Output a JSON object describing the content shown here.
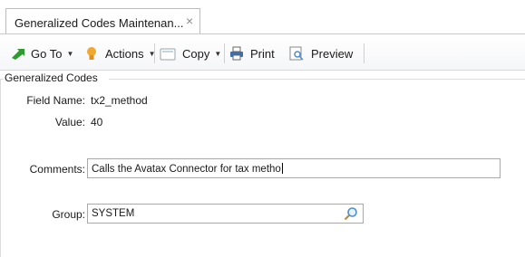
{
  "tab": {
    "title": "Generalized Codes Maintenan...",
    "close": "×"
  },
  "toolbar": {
    "goto_label": "Go To",
    "actions_label": "Actions",
    "copy_label": "Copy",
    "print_label": "Print",
    "preview_label": "Preview"
  },
  "group": {
    "title": "Generalized Codes"
  },
  "form": {
    "field_name_label": "Field Name:",
    "field_name_value": "tx2_method",
    "value_label": "Value:",
    "value_value": "40",
    "comments_label": "Comments:",
    "comments_value": "Calls the Avatax Connector for tax metho",
    "group_label": "Group:",
    "group_value": "SYSTEM"
  },
  "colors": {
    "goto_icon": "#2e9b2e",
    "actions_icon": "#f0a830",
    "print_icon": "#3a6fb0",
    "search_icon": "#4a8fd0"
  },
  "icons": [
    "goto-arrow-icon",
    "lightbulb-icon",
    "copy-icon",
    "printer-icon",
    "preview-icon",
    "search-icon",
    "close-icon"
  ]
}
